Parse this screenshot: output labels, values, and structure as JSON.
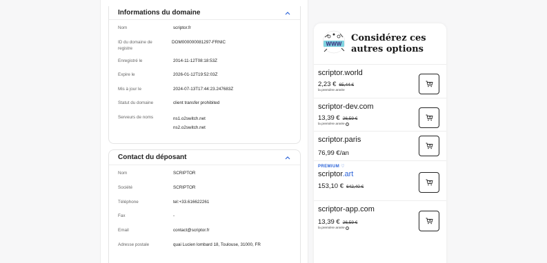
{
  "domain_info": {
    "title": "Informations du domaine",
    "rows": [
      {
        "label": "Nom",
        "value": "scriptor.fr"
      },
      {
        "label": "ID du domaine de registre",
        "value": "DOM000000081297-FRNIC"
      },
      {
        "label": "Enregistré le",
        "value": "2014-11-12T08:18:53Z"
      },
      {
        "label": "Expire le",
        "value": "2026-01-12T19:52:03Z"
      },
      {
        "label": "Mis à jour le",
        "value": "2024-07-13T17:44:23.247683Z"
      },
      {
        "label": "Statut du domaine",
        "value": "client transfer prohibited"
      },
      {
        "label": "Serveurs de noms",
        "value": "ns1.o2switch.net",
        "value2": "ns2.o2switch.net"
      }
    ]
  },
  "contact": {
    "title": "Contact du déposant",
    "rows": [
      {
        "label": "Nom",
        "value": "SCRIPTOR"
      },
      {
        "label": "Société",
        "value": "SCRIPTOR"
      },
      {
        "label": "Téléphone",
        "value": "tel:+33.616622261"
      },
      {
        "label": "Fax",
        "value": "-"
      },
      {
        "label": "Email",
        "value": "contact@scriptor.fr"
      },
      {
        "label": "Adresse postale",
        "value": "quai Lucien lombard 18, Toulouse, 31000, FR"
      }
    ]
  },
  "suggestions": {
    "title": "Considérez ces autres options",
    "first_year_note": "la première année",
    "items": [
      {
        "name": "scriptor.world",
        "price": "2,23 €",
        "old_price": "65,44 €",
        "note": true
      },
      {
        "name": "scriptor-dev.com",
        "price": "13,39 €",
        "old_price": "26,59 €",
        "note": true
      },
      {
        "name": "scriptor.paris",
        "price": "76,99 €/an",
        "old_price": "",
        "note": false
      },
      {
        "badge": "PREMIUM",
        "name_base": "scriptor",
        "name_tld": ".art",
        "price": "153,10 €",
        "old_price": "642,40 €",
        "note": false
      },
      {
        "name": "scriptor-app.com",
        "price": "13,39 €",
        "old_price": "26,59 €",
        "note": true
      }
    ]
  }
}
